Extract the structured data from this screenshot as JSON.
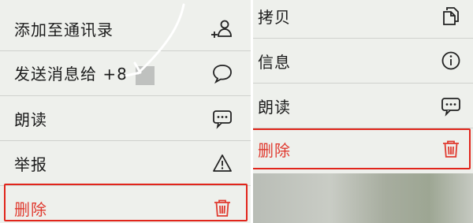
{
  "left_menu": {
    "items": [
      {
        "label": "添加至通讯录",
        "icon": "add-contact-icon"
      },
      {
        "label": "发送消息给 +8",
        "icon": "chat-bubble-icon"
      },
      {
        "label": "朗读",
        "icon": "speech-bubble-dots-icon"
      },
      {
        "label": "举报",
        "icon": "warning-triangle-icon"
      },
      {
        "label": "删除",
        "icon": "trash-icon"
      }
    ]
  },
  "right_menu": {
    "items": [
      {
        "label": "拷贝",
        "icon": "copy-icon"
      },
      {
        "label": "信息",
        "icon": "info-icon"
      },
      {
        "label": "朗读",
        "icon": "speech-bubble-dots-icon"
      },
      {
        "label": "删除",
        "icon": "trash-icon"
      }
    ]
  },
  "colors": {
    "danger": "#e03a2f",
    "highlight": "#e1251b",
    "text": "#1b1b1b",
    "menu_bg": "#eef0ec"
  }
}
